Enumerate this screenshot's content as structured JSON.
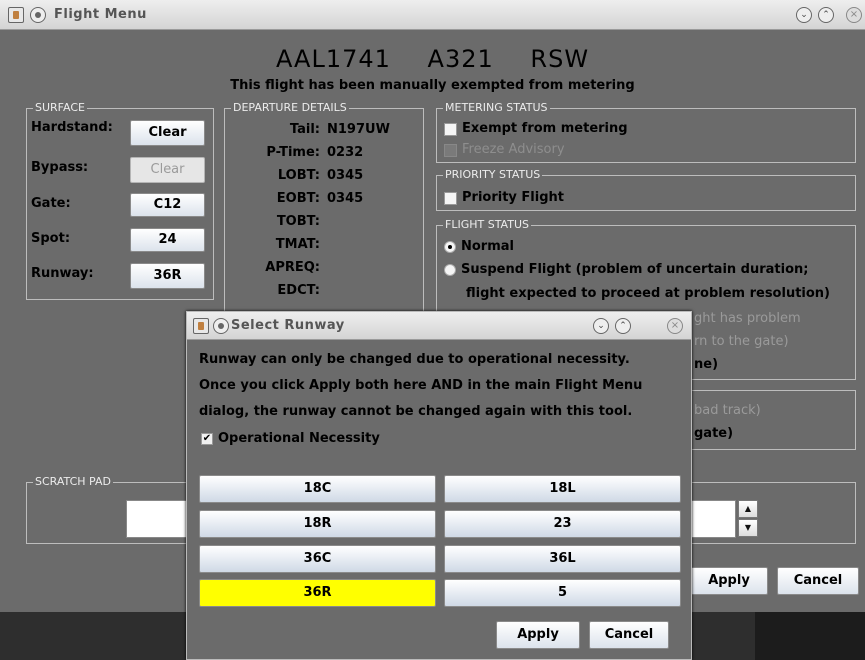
{
  "main_window": {
    "title": "Flight Menu",
    "flight": {
      "callsign": "AAL1741",
      "aircraft": "A321",
      "destination": "RSW"
    },
    "exempt_note": "This flight has been manually exempted from metering",
    "surface": {
      "legend": "SURFACE",
      "rows": [
        {
          "label": "Hardstand:",
          "button": "Clear",
          "enabled": true
        },
        {
          "label": "Bypass:",
          "button": "Clear",
          "enabled": false
        },
        {
          "label": "Gate:",
          "button": "C12",
          "enabled": true
        },
        {
          "label": "Spot:",
          "button": "24",
          "enabled": true
        },
        {
          "label": "Runway:",
          "button": "36R",
          "enabled": true
        }
      ]
    },
    "departure": {
      "legend": "DEPARTURE DETAILS",
      "rows": [
        {
          "label": "Tail:",
          "value": "N197UW"
        },
        {
          "label": "P-Time:",
          "value": "0232"
        },
        {
          "label": "LOBT:",
          "value": "0345"
        },
        {
          "label": "EOBT:",
          "value": "0345"
        },
        {
          "label": "TOBT:",
          "value": ""
        },
        {
          "label": "TMAT:",
          "value": ""
        },
        {
          "label": "APREQ:",
          "value": ""
        },
        {
          "label": "EDCT:",
          "value": ""
        }
      ]
    },
    "metering": {
      "legend": "METERING STATUS",
      "exempt": "Exempt from metering",
      "freeze": "Freeze Advisory"
    },
    "priority": {
      "legend": "PRIORITY STATUS",
      "flight": "Priority Flight"
    },
    "flight_status": {
      "legend": "FLIGHT STATUS",
      "normal": "Normal",
      "suspend_line1": "Suspend Flight (problem of uncertain duration;",
      "suspend_line2": "flight expected to proceed at problem resolution)",
      "ghost1": "ght has problem",
      "ghost2": "rn to the gate)",
      "frag1": "ne)"
    },
    "lower_frags": {
      "ghost": "bad track)",
      "frag": "gate)"
    },
    "scratch_pad": {
      "legend": "SCRATCH PAD"
    },
    "buttons": {
      "apply": "Apply",
      "cancel": "Cancel"
    }
  },
  "dialog": {
    "title": "Select Runway",
    "message": [
      "Runway can only be changed due to operational necessity.",
      "Once you click Apply both here AND in the main Flight Menu",
      "dialog, the runway cannot be changed again with this tool."
    ],
    "check_mark": "✔",
    "checkbox_label": "Operational Necessity",
    "runways": [
      "18C",
      "18L",
      "18R",
      "23",
      "36C",
      "36L",
      "36R",
      "5"
    ],
    "selected": "36R",
    "apply": "Apply",
    "cancel": "Cancel"
  },
  "icons": {
    "chevron_down": "⌄",
    "chevron_up": "⌃",
    "close": "×",
    "spin_up": "▲",
    "spin_down": "▼"
  },
  "colors": {
    "background": "#6b6b6b",
    "selected": "#ffff00",
    "label_light": "#ececec"
  }
}
